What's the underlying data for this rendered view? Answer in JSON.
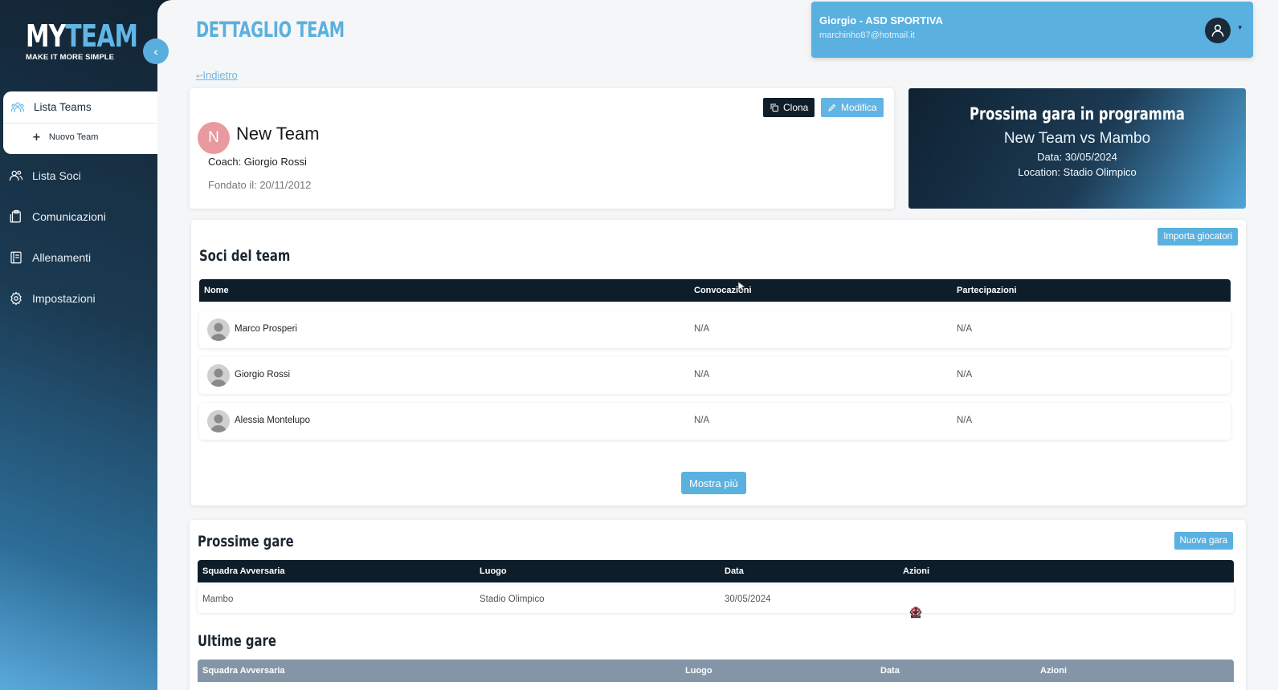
{
  "sidebar": {
    "logo_my": "MY",
    "logo_team": "TEAM",
    "logo_tagline": "MAKE IT MORE SIMPLE",
    "active_item": "Lista Teams",
    "sub_item": "Nuovo Team",
    "items": [
      {
        "label": "Lista Soci",
        "icon": "users-icon"
      },
      {
        "label": "Comunicazioni",
        "icon": "clipboard-icon"
      },
      {
        "label": "Allenamenti",
        "icon": "notebook-icon"
      },
      {
        "label": "Impostazioni",
        "icon": "gear-icon"
      }
    ]
  },
  "header": {
    "page_title": "DETTAGLIO TEAM",
    "back_label": "Indietro",
    "user_name": "Giorgio - ASD SPORTIVA",
    "user_email": "marchinho87@hotmail.it"
  },
  "team": {
    "initial": "N",
    "name": "New Team",
    "coach": "Coach: Giorgio Rossi",
    "founded": "Fondato il: 20/11/2012",
    "clone_label": "Clona",
    "edit_label": "Modifica",
    "avatar_color": "#e89a9e"
  },
  "next_match": {
    "title": "Prossima gara in programma",
    "matchup": "New Team vs Mambo",
    "date": "Data: 30/05/2024",
    "location": "Location: Stadio Olimpico"
  },
  "members": {
    "title": "Soci del team",
    "import_label": "Importa giocatori",
    "columns": [
      "Nome",
      "Convocazioni",
      "Partecipazioni"
    ],
    "rows": [
      {
        "name": "Marco Prosperi",
        "convocazioni": "N/A",
        "partecipazioni": "N/A"
      },
      {
        "name": "Giorgio Rossi",
        "convocazioni": "N/A",
        "partecipazioni": "N/A"
      },
      {
        "name": "Alessia Montelupo",
        "convocazioni": "N/A",
        "partecipazioni": "N/A"
      }
    ],
    "show_more_label": "Mostra più"
  },
  "upcoming": {
    "title": "Prossime gare",
    "new_label": "Nuova gara",
    "columns": [
      "Squadra Avversaria",
      "Luogo",
      "Data",
      "Azioni"
    ],
    "rows": [
      {
        "opponent": "Mambo",
        "place": "Stadio Olimpico",
        "date": "30/05/2024"
      }
    ]
  },
  "past": {
    "title": "Ultime gare",
    "columns": [
      "Squadra Avversaria",
      "Luogo",
      "Data",
      "Azioni"
    ]
  },
  "colors": {
    "accent": "#5ab1e0",
    "dark": "#0e1d2a",
    "danger": "#c0343f"
  }
}
